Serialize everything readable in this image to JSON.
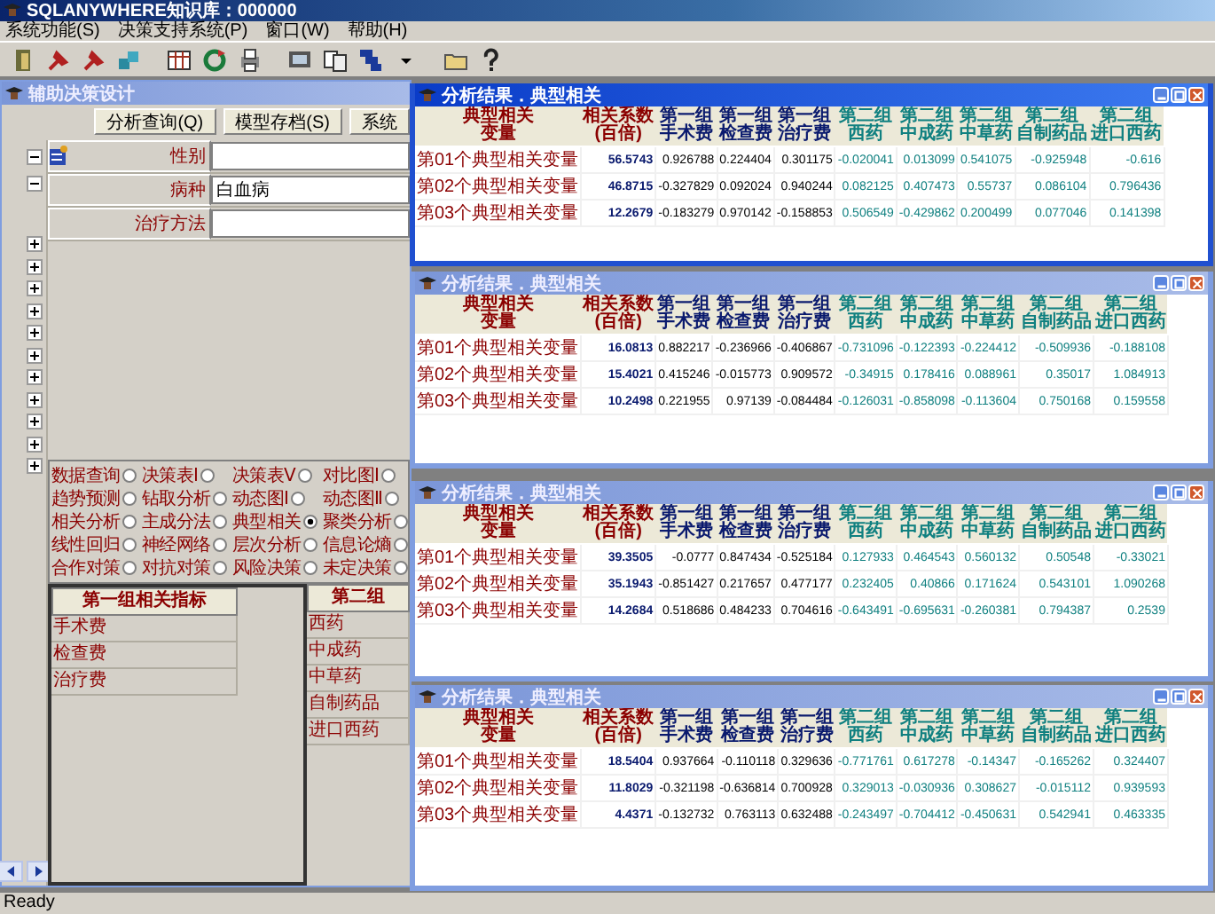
{
  "window": {
    "title": "SQLANYWHERE知识库：000000"
  },
  "menu": [
    "系统功能(S)",
    "决策支持系统(P)",
    "窗口(W)",
    "帮助(H)"
  ],
  "design_window": {
    "title": "辅助决策设计",
    "buttons": [
      "分析查询(Q)",
      "模型存档(S)",
      "系统"
    ],
    "tree": [
      {
        "expanded": true
      },
      {
        "expanded": true
      },
      {
        "expanded": false
      },
      {
        "expanded": false
      },
      {
        "expanded": false
      },
      {
        "expanded": false
      },
      {
        "expanded": false
      },
      {
        "expanded": false
      },
      {
        "expanded": false
      },
      {
        "expanded": false
      },
      {
        "expanded": false
      },
      {
        "expanded": false
      },
      {
        "expanded": false
      }
    ],
    "form": [
      {
        "label": "性别"
      },
      {
        "label": "病种",
        "value": "白血病"
      },
      {
        "label": "治疗方法"
      }
    ],
    "methods": [
      {
        "label": "数据查询",
        "selected": false
      },
      {
        "label": "决策表Ⅰ",
        "selected": false
      },
      {
        "label": "决策表Ⅴ",
        "selected": false
      },
      {
        "label": "对比图Ⅰ",
        "selected": false
      },
      {
        "label": "趋势预测",
        "selected": false
      },
      {
        "label": "钻取分析",
        "selected": false
      },
      {
        "label": "动态图Ⅰ",
        "selected": false
      },
      {
        "label": "动态图Ⅱ",
        "selected": false
      },
      {
        "label": "相关分析",
        "selected": false
      },
      {
        "label": "主成分法",
        "selected": false
      },
      {
        "label": "典型相关",
        "selected": true
      },
      {
        "label": "聚类分析",
        "selected": false
      },
      {
        "label": "线性回归",
        "selected": false
      },
      {
        "label": "神经网络",
        "selected": false
      },
      {
        "label": "层次分析",
        "selected": false
      },
      {
        "label": "信息论熵",
        "selected": false
      },
      {
        "label": "合作对策",
        "selected": false
      },
      {
        "label": "对抗对策",
        "selected": false
      },
      {
        "label": "风险决策",
        "selected": false
      },
      {
        "label": "未定决策",
        "selected": false
      }
    ],
    "group1": {
      "title": "第一组相关指标",
      "items": [
        "手术费",
        "检查费",
        "治疗费"
      ]
    },
    "group2": {
      "title": "第二组",
      "items": [
        "西药",
        "中成药",
        "中草药",
        "自制药品",
        "进口西药"
      ]
    }
  },
  "result_windows": [
    {
      "title": "分析结果．典型相关",
      "active": true,
      "columns": [
        {
          "lines": [
            "典型相关",
            "变量"
          ],
          "kind": "label"
        },
        {
          "lines": [
            "相关系数",
            "(百倍)"
          ],
          "kind": "coef"
        },
        {
          "lines": [
            "第一组",
            "手术费"
          ],
          "kind": "group1"
        },
        {
          "lines": [
            "第一组",
            "检查费"
          ],
          "kind": "group1"
        },
        {
          "lines": [
            "第一组",
            "治疗费"
          ],
          "kind": "group1"
        },
        {
          "lines": [
            "第二组",
            "西药"
          ],
          "kind": "group2"
        },
        {
          "lines": [
            "第二组",
            "中成药"
          ],
          "kind": "group2"
        },
        {
          "lines": [
            "第二组",
            "中草药"
          ],
          "kind": "group2"
        },
        {
          "lines": [
            "第二组",
            "自制药品"
          ],
          "kind": "group2"
        },
        {
          "lines": [
            "第二组",
            "进口西药"
          ],
          "kind": "group2"
        }
      ],
      "rows": [
        [
          "第01个典型相关变量",
          "56.5743",
          "0.926788",
          "0.224404",
          "0.301175",
          "-0.020041",
          "0.013099",
          "0.541075",
          "-0.925948",
          "-0.616"
        ],
        [
          "第02个典型相关变量",
          "46.8715",
          "-0.327829",
          "0.092024",
          "0.940244",
          "0.082125",
          "0.407473",
          "0.55737",
          "0.086104",
          "0.796436"
        ],
        [
          "第03个典型相关变量",
          "12.2679",
          "-0.183279",
          "0.970142",
          "-0.158853",
          "0.506549",
          "-0.429862",
          "0.200499",
          "0.077046",
          "0.141398"
        ]
      ]
    },
    {
      "title": "分析结果．典型相关",
      "active": false,
      "columns": [
        {
          "lines": [
            "典型相关",
            "变量"
          ],
          "kind": "label"
        },
        {
          "lines": [
            "相关系数",
            "(百倍)"
          ],
          "kind": "coef"
        },
        {
          "lines": [
            "第一组",
            "手术费"
          ],
          "kind": "group1"
        },
        {
          "lines": [
            "第一组",
            "检查费"
          ],
          "kind": "group1"
        },
        {
          "lines": [
            "第一组",
            "治疗费"
          ],
          "kind": "group1"
        },
        {
          "lines": [
            "第二组",
            "西药"
          ],
          "kind": "group2"
        },
        {
          "lines": [
            "第二组",
            "中成药"
          ],
          "kind": "group2"
        },
        {
          "lines": [
            "第二组",
            "中草药"
          ],
          "kind": "group2"
        },
        {
          "lines": [
            "第二组",
            "自制药品"
          ],
          "kind": "group2"
        },
        {
          "lines": [
            "第二组",
            "进口西药"
          ],
          "kind": "group2"
        }
      ],
      "rows": [
        [
          "第01个典型相关变量",
          "16.0813",
          "0.882217",
          "-0.236966",
          "-0.406867",
          "-0.731096",
          "-0.122393",
          "-0.224412",
          "-0.509936",
          "-0.188108"
        ],
        [
          "第02个典型相关变量",
          "15.4021",
          "0.415246",
          "-0.015773",
          "0.909572",
          "-0.34915",
          "0.178416",
          "0.088961",
          "0.35017",
          "1.084913"
        ],
        [
          "第03个典型相关变量",
          "10.2498",
          "0.221955",
          "0.97139",
          "-0.084484",
          "-0.126031",
          "-0.858098",
          "-0.113604",
          "0.750168",
          "0.159558"
        ]
      ]
    },
    {
      "title": "分析结果．典型相关",
      "active": false,
      "columns": [
        {
          "lines": [
            "典型相关",
            "变量"
          ],
          "kind": "label"
        },
        {
          "lines": [
            "相关系数",
            "(百倍)"
          ],
          "kind": "coef"
        },
        {
          "lines": [
            "第一组",
            "手术费"
          ],
          "kind": "group1"
        },
        {
          "lines": [
            "第一组",
            "检查费"
          ],
          "kind": "group1"
        },
        {
          "lines": [
            "第一组",
            "治疗费"
          ],
          "kind": "group1"
        },
        {
          "lines": [
            "第二组",
            "西药"
          ],
          "kind": "group2"
        },
        {
          "lines": [
            "第二组",
            "中成药"
          ],
          "kind": "group2"
        },
        {
          "lines": [
            "第二组",
            "中草药"
          ],
          "kind": "group2"
        },
        {
          "lines": [
            "第二组",
            "自制药品"
          ],
          "kind": "group2"
        },
        {
          "lines": [
            "第二组",
            "进口西药"
          ],
          "kind": "group2"
        }
      ],
      "rows": [
        [
          "第01个典型相关变量",
          "39.3505",
          "-0.0777",
          "0.847434",
          "-0.525184",
          "0.127933",
          "0.464543",
          "0.560132",
          "0.50548",
          "-0.33021"
        ],
        [
          "第02个典型相关变量",
          "35.1943",
          "-0.851427",
          "0.217657",
          "0.477177",
          "0.232405",
          "0.40866",
          "0.171624",
          "0.543101",
          "1.090268"
        ],
        [
          "第03个典型相关变量",
          "14.2684",
          "0.518686",
          "0.484233",
          "0.704616",
          "-0.643491",
          "-0.695631",
          "-0.260381",
          "0.794387",
          "0.2539"
        ]
      ]
    },
    {
      "title": "分析结果．典型相关",
      "active": false,
      "columns": [
        {
          "lines": [
            "典型相关",
            "变量"
          ],
          "kind": "label"
        },
        {
          "lines": [
            "相关系数",
            "(百倍)"
          ],
          "kind": "coef"
        },
        {
          "lines": [
            "第一组",
            "手术费"
          ],
          "kind": "group1"
        },
        {
          "lines": [
            "第一组",
            "检查费"
          ],
          "kind": "group1"
        },
        {
          "lines": [
            "第一组",
            "治疗费"
          ],
          "kind": "group1"
        },
        {
          "lines": [
            "第二组",
            "西药"
          ],
          "kind": "group2"
        },
        {
          "lines": [
            "第二组",
            "中成药"
          ],
          "kind": "group2"
        },
        {
          "lines": [
            "第二组",
            "中草药"
          ],
          "kind": "group2"
        },
        {
          "lines": [
            "第二组",
            "自制药品"
          ],
          "kind": "group2"
        },
        {
          "lines": [
            "第二组",
            "进口西药"
          ],
          "kind": "group2"
        }
      ],
      "rows": [
        [
          "第01个典型相关变量",
          "18.5404",
          "0.937664",
          "-0.110118",
          "0.329636",
          "-0.771761",
          "0.617278",
          "-0.14347",
          "-0.165262",
          "0.324407"
        ],
        [
          "第02个典型相关变量",
          "11.8029",
          "-0.321198",
          "-0.636814",
          "0.700928",
          "0.329013",
          "-0.030936",
          "0.308627",
          "-0.015112",
          "0.939593"
        ],
        [
          "第03个典型相关变量",
          "4.4371",
          "-0.132732",
          "0.763113",
          "0.632488",
          "-0.243497",
          "-0.704412",
          "-0.450631",
          "0.542941",
          "0.463335"
        ]
      ]
    }
  ],
  "status_bar": "Ready"
}
